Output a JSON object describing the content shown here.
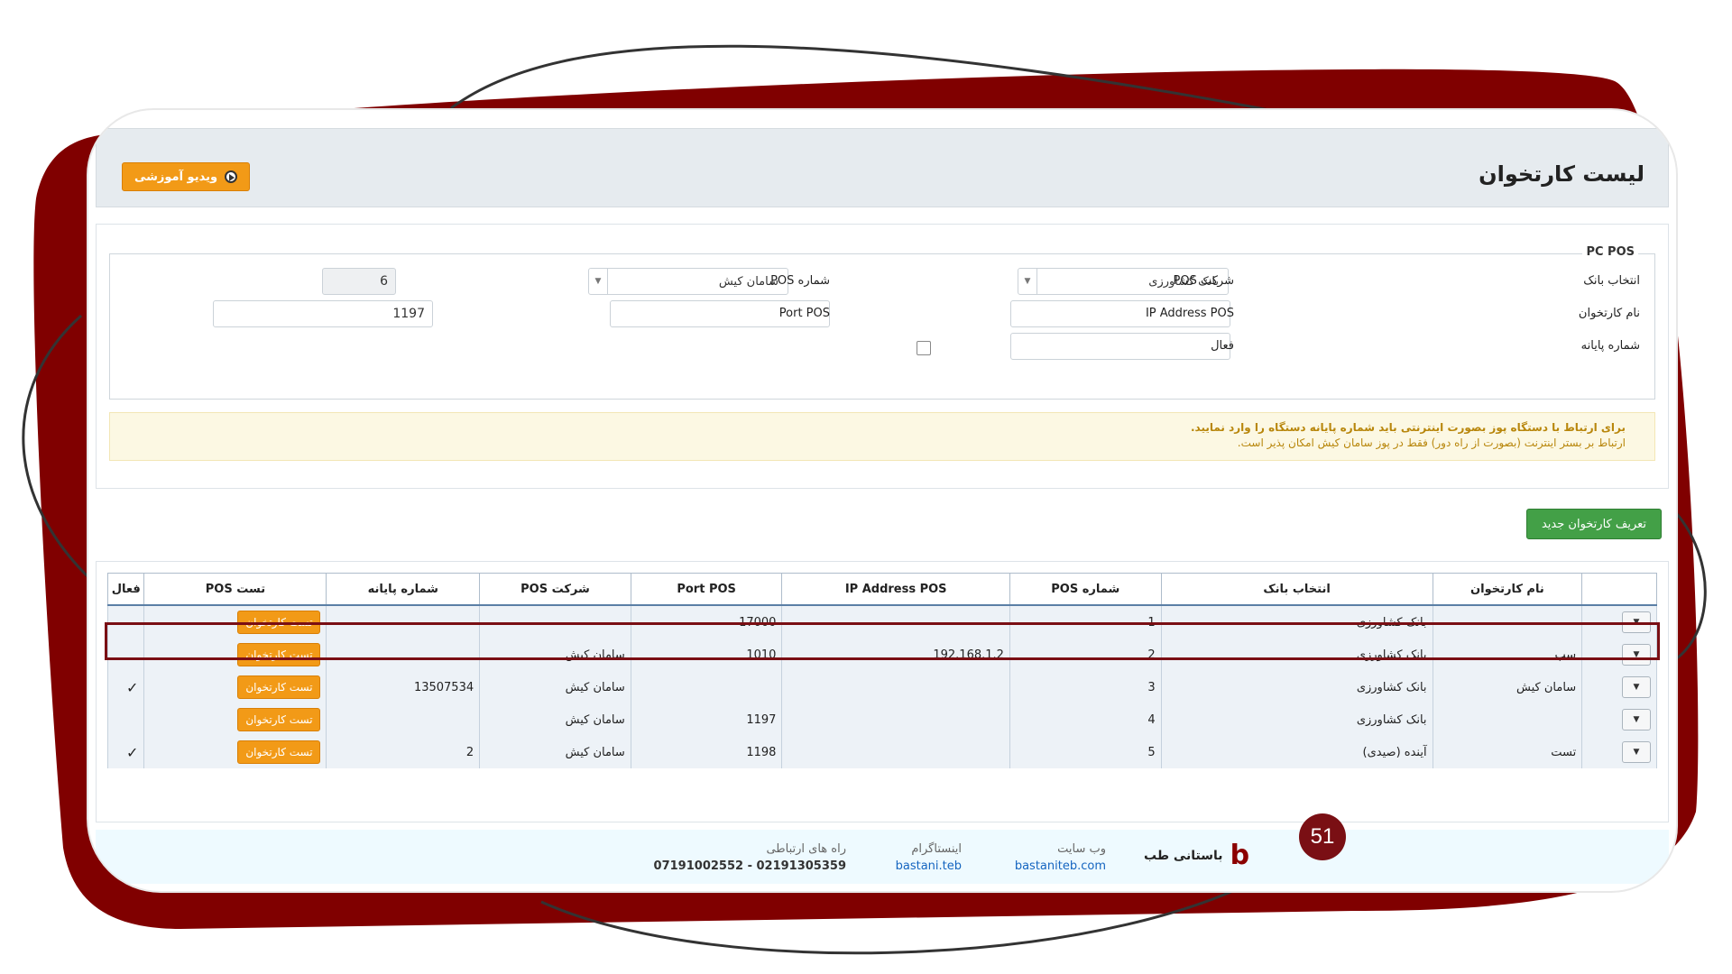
{
  "header": {
    "title": "لیست کارتخوان",
    "video_button_label": "ویدیو آموزشی"
  },
  "form": {
    "legend": "PC POS",
    "bank_label": "انتخاب بانک",
    "bank_value": "بانک کشاورزی",
    "pos_company_label": "شرکت POS",
    "pos_company_value": "سامان کیش",
    "pos_number_label": "شماره POS",
    "pos_number_value": "6",
    "reader_name_label": "نام کارتخوان",
    "reader_name_value": "",
    "ip_label": "IP Address POS",
    "ip_value": "",
    "port_label": "Port POS",
    "port_value": "1197",
    "terminal_label": "شماره پایانه",
    "terminal_value": "",
    "active_label": "فعال"
  },
  "notice": {
    "line1": "برای ارتباط با دستگاه پوز بصورت اینترنتی باید شماره پایانه دستگاه را وارد نمایید.",
    "line2": "ارتباط بر بستر اینترنت (بصورت از راه دور) فقط در پوز سامان کیش امکان پذیر است."
  },
  "new_button_label": "تعریف کارتخوان جدید",
  "table": {
    "columns": [
      "",
      "نام کارتخوان",
      "انتخاب بانک",
      "شماره POS",
      "IP Address POS",
      "Port POS",
      "شرکت POS",
      "شماره پایانه",
      "تست POS",
      "فعال"
    ],
    "test_label": "تست کارتخوان",
    "rows": [
      {
        "name": "",
        "bank": "بانک کشاورزی",
        "pos": "1",
        "ip": "",
        "port": "17000",
        "company": "",
        "terminal": "",
        "active": ""
      },
      {
        "name": "سپ",
        "bank": "بانک کشاورزی",
        "pos": "2",
        "ip": "192.168.1.2",
        "port": "1010",
        "company": "سامان کیش",
        "terminal": "",
        "active": ""
      },
      {
        "name": "سامان کیش",
        "bank": "بانک کشاورزی",
        "pos": "3",
        "ip": "",
        "port": "",
        "company": "سامان کیش",
        "terminal": "13507534",
        "active": "✓"
      },
      {
        "name": "",
        "bank": "بانک کشاورزی",
        "pos": "4",
        "ip": "",
        "port": "1197",
        "company": "سامان کیش",
        "terminal": "",
        "active": ""
      },
      {
        "name": "تست",
        "bank": "آینده (صیدی)",
        "pos": "5",
        "ip": "",
        "port": "1198",
        "company": "سامان کیش",
        "terminal": "2",
        "active": "✓"
      }
    ]
  },
  "footer": {
    "brand": "باستانی طب",
    "website_label": "وب سایت",
    "website": "bastaniteb.com",
    "instagram_label": "اینستاگرام",
    "instagram": "bastani.teb",
    "contact_label": "راه های ارتباطی",
    "phones": "07191002552 - 02191305359"
  },
  "badge_number": "51",
  "colors": {
    "accent": "#7a0f14",
    "orange": "#f29a17",
    "green": "#43a047"
  }
}
